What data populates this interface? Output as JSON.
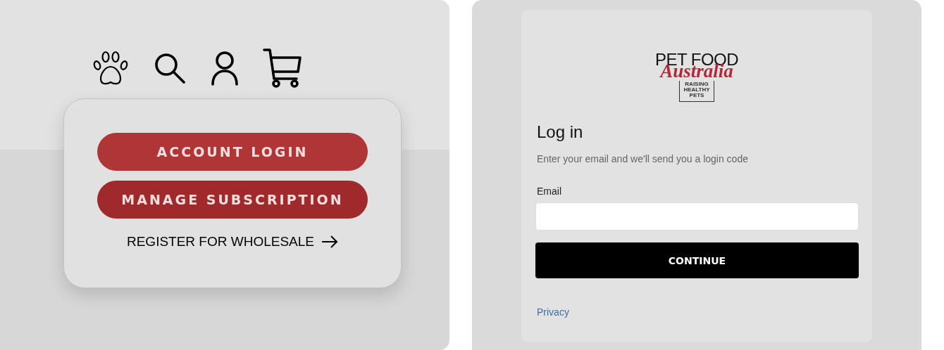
{
  "account_menu": {
    "items": [
      {
        "kind": "button",
        "label": "ACCOUNT LOGIN",
        "color": "#b03536"
      },
      {
        "kind": "button",
        "label": "MANAGE SUBSCRIPTION",
        "color": "#a0292c"
      },
      {
        "kind": "link",
        "label": "REGISTER FOR WHOLESALE"
      }
    ]
  },
  "login": {
    "logo": {
      "line_1": "PET FOOD",
      "line_2": "Australia",
      "tagline": "RAISING HEALTHY PETS"
    },
    "title": "Log in",
    "subtitle": "Enter your email and we'll send you a login code",
    "email_label": "Email",
    "submit": "CONTINUE",
    "footer_link": "Privacy"
  }
}
